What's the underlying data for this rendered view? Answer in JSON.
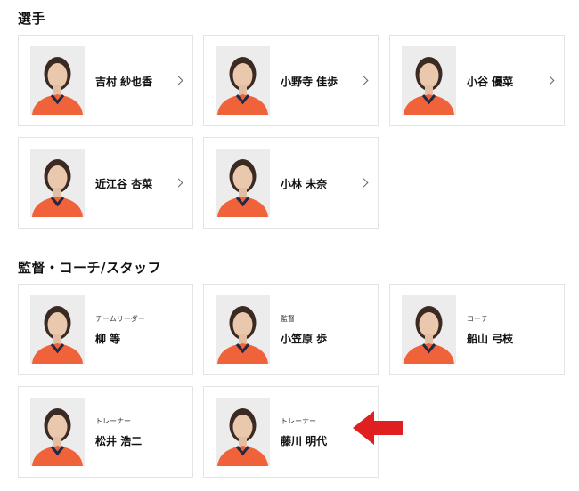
{
  "players_section": {
    "title": "選手"
  },
  "players": [
    {
      "name": "吉村 紗也香"
    },
    {
      "name": "小野寺 佳歩"
    },
    {
      "name": "小谷 優菜"
    },
    {
      "name": "近江谷 杏菜"
    },
    {
      "name": "小林 未奈"
    }
  ],
  "staff_section": {
    "title": "監督・コーチ/スタッフ"
  },
  "staff": [
    {
      "role": "チームリーダー",
      "name": "柳 等"
    },
    {
      "role": "監督",
      "name": "小笠原 歩"
    },
    {
      "role": "コーチ",
      "name": "船山 弓枝"
    },
    {
      "role": "トレーナー",
      "name": "松井 浩二"
    },
    {
      "role": "トレーナー",
      "name": "藤川 明代"
    }
  ],
  "icons": {
    "chevron": "chevron-right-icon",
    "annotation_arrow": "arrow-left-icon"
  },
  "colors": {
    "jersey": "#f0633a",
    "arrow": "#e02020"
  }
}
